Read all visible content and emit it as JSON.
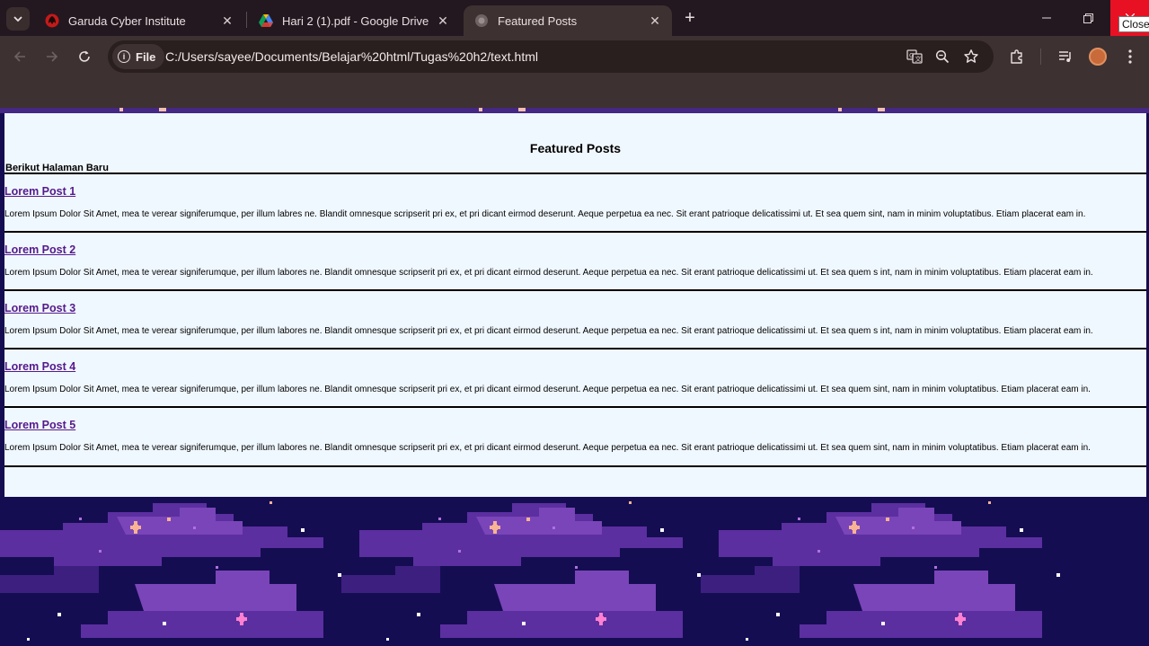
{
  "tabs": [
    {
      "title": "Garuda Cyber Institute",
      "icon": "garuda-icon"
    },
    {
      "title": "Hari 2 (1).pdf - Google Drive",
      "icon": "google-drive-icon"
    },
    {
      "title": "Featured Posts",
      "icon": "globe-icon"
    }
  ],
  "window": {
    "close_tooltip": "Close"
  },
  "omnibox": {
    "chip_label": "File",
    "url": "C:/Users/sayee/Documents/Belajar%20html/Tugas%20h2/text.html"
  },
  "page": {
    "heading": "Featured Posts",
    "subtitle": "Berikut Halaman Baru",
    "posts": [
      {
        "title": "Lorem Post 1",
        "body": "Lorem Ipsum Dolor Sit Amet, mea te verear signiferumque, per illum labres ne. Blandit omnesque scripserit pri ex, et pri dicant eirmod deserunt. Aeque perpetua ea nec. Sit erant patrioque delicatissimi ut. Et sea quem sint, nam in minim voluptatibus. Etiam placerat eam in."
      },
      {
        "title": "Lorem Post 2",
        "body": "Lorem Ipsum Dolor Sit Amet, mea te verear signiferumque, per illum labores ne. Blandit omnesque scripserit pri ex, et pri dicant eirmod deserunt. Aeque perpetua ea nec. Sit erant patrioque delicatissimi ut. Et sea quem s int, nam in minim voluptatibus. Etiam placerat eam in."
      },
      {
        "title": "Lorem Post 3",
        "body": "Lorem Ipsum Dolor Sit Amet, mea te verear signiferumque, per illum labores ne. Blandit omnesque scripserit pri ex, et pri dicant eirmod deserunt. Aeque perpetua ea nec. Sit erant patrioque delicatissimi ut. Et sea quem s int, nam in minim voluptatibus. Etiam placerat eam in."
      },
      {
        "title": "Lorem Post 4",
        "body": "Lorem Ipsum Dolor Sit Amet, mea te verear signiferumque, per illum labores ne. Blandit omnesque scripserit pri ex, et pri dicant eirmod deserunt. Aeque perpetua ea nec. Sit erant patrioque delicatissimi ut. Et sea quem sint, nam in minim voluptatibus. Etiam placerat eam in."
      },
      {
        "title": "Lorem Post 5",
        "body": "Lorem Ipsum Dolor Sit Amet, mea te verear signiferumque, per illum labores ne. Blandit omnesque scripserit pri ex, et pri dicant eirmod deserunt. Aeque perpetua ea nec. Sit erant patrioque delicatissimi ut. Et sea quem sint, nam in minim voluptatibus. Etiam placerat eam in."
      }
    ]
  },
  "colors": {
    "link": "#551a8b",
    "page_bg": "#f0f8ff",
    "sky": "#150d52",
    "close_btn": "#e81123"
  }
}
